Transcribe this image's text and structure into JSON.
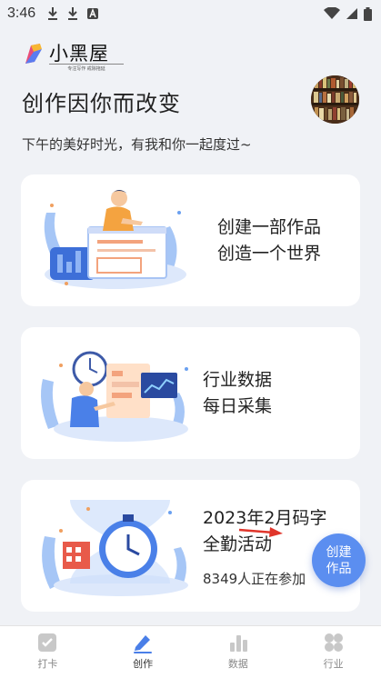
{
  "status_bar": {
    "time": "3:46"
  },
  "logo": {
    "name": "小黑屋",
    "tagline": "专注写作 戒除拖延"
  },
  "header": {
    "title": "创作因你而改变",
    "subtitle": "下午的美好时光，有我和你一起度过~"
  },
  "cards": [
    {
      "line1": "创建一部作品",
      "line2": "创造一个世界"
    },
    {
      "line1": "行业数据",
      "line2": "每日采集"
    },
    {
      "line1": "2023年2月码字",
      "line2": "全勤活动",
      "participants": "8349人正在参加"
    }
  ],
  "fab": {
    "label": "创建作品"
  },
  "tabs": [
    {
      "label": "打卡",
      "icon": "check-square-icon"
    },
    {
      "label": "创作",
      "icon": "pen-icon"
    },
    {
      "label": "数据",
      "icon": "bar-chart-icon"
    },
    {
      "label": "行业",
      "icon": "grid-icon"
    }
  ],
  "colors": {
    "accent": "#5b8ef0",
    "tab_active": "#4a7fe8",
    "background": "#f0f2f6"
  }
}
